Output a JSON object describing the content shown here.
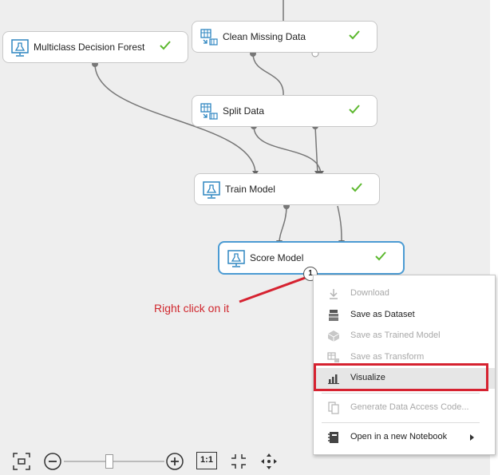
{
  "modules": {
    "multiclass_decision_forest": {
      "label": "Multiclass Decision Forest"
    },
    "clean_missing_data": {
      "label": "Clean Missing Data"
    },
    "split_data": {
      "label": "Split Data"
    },
    "train_model": {
      "label": "Train Model"
    },
    "score_model": {
      "label": "Score Model"
    }
  },
  "port_badge": "1",
  "annotation": "Right click on it",
  "context_menu": {
    "items": [
      {
        "label": "Download",
        "enabled": false,
        "icon": "download-icon"
      },
      {
        "label": "Save as Dataset",
        "enabled": true,
        "icon": "dataset-icon"
      },
      {
        "label": "Save as Trained Model",
        "enabled": false,
        "icon": "trained-model-icon"
      },
      {
        "label": "Save as Transform",
        "enabled": false,
        "icon": "transform-icon"
      },
      {
        "label": "Visualize",
        "enabled": true,
        "icon": "bar-chart-icon",
        "highlighted": true
      },
      {
        "label": "Generate Data Access Code...",
        "enabled": false,
        "icon": "code-icon"
      },
      {
        "label": "Open in a new Notebook",
        "enabled": true,
        "icon": "notebook-icon",
        "submenu": true
      }
    ]
  },
  "zoom_toolbar": {
    "actual_size_label": "1:1",
    "zoom_level": 0.45
  },
  "colors": {
    "accent_selected": "#4b9bd3",
    "success_check": "#5cb82e",
    "annotation_red": "#d0282e",
    "highlight_box": "#d62230"
  }
}
